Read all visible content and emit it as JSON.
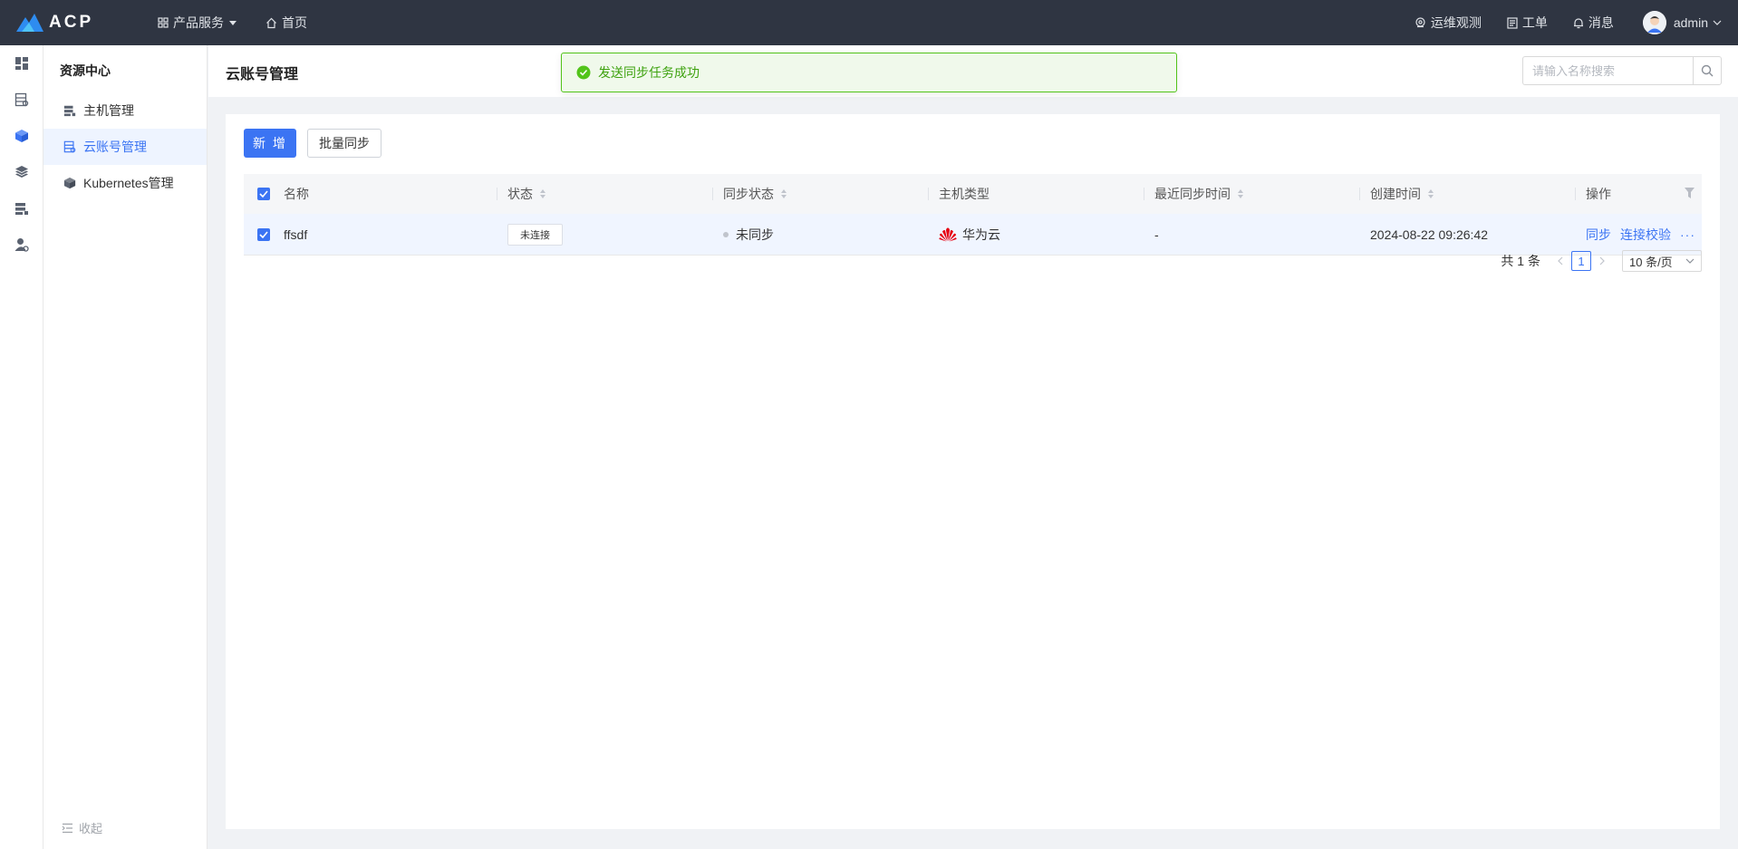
{
  "header": {
    "logo_text": "ACP",
    "nav": [
      {
        "label": "产品服务",
        "icon": "grid-icon"
      },
      {
        "label": "首页",
        "icon": "home-icon"
      }
    ],
    "right": [
      {
        "label": "运维观测",
        "icon": "location-icon"
      },
      {
        "label": "工单",
        "icon": "document-icon"
      },
      {
        "label": "消息",
        "icon": "bell-icon"
      }
    ],
    "user": "admin"
  },
  "rail": [
    "dashboard-icon",
    "resource-list-icon",
    "cube-icon",
    "layers-icon",
    "server-icon",
    "user-settings-icon"
  ],
  "sidebar": {
    "title": "资源中心",
    "items": [
      {
        "label": "主机管理",
        "icon": "server-icon",
        "active": false
      },
      {
        "label": "云账号管理",
        "icon": "cloud-account-icon",
        "active": true
      },
      {
        "label": "Kubernetes管理",
        "icon": "cube-icon",
        "active": false
      }
    ],
    "collapse_label": "收起"
  },
  "page": {
    "title": "云账号管理",
    "search_placeholder": "请输入名称搜索"
  },
  "toast": {
    "message": "发送同步任务成功",
    "type": "success"
  },
  "toolbar": {
    "add_label": "新 增",
    "batch_sync_label": "批量同步"
  },
  "table": {
    "columns": [
      "名称",
      "状态",
      "同步状态",
      "主机类型",
      "最近同步时间",
      "创建时间",
      "操作"
    ],
    "rows": [
      {
        "name": "ffsdf",
        "status": "未连接",
        "sync_status": "未同步",
        "host_type": "华为云",
        "last_sync": "-",
        "created": "2024-08-22 09:26:42",
        "actions": [
          "同步",
          "连接校验"
        ],
        "more": "···"
      }
    ]
  },
  "pagination": {
    "total_label": "共 1 条",
    "current_page": "1",
    "page_size": "10 条/页"
  },
  "colors": {
    "primary": "#3b74f3",
    "topbar": "#2f3542",
    "success": "#52c41a",
    "huawei_red": "#e60012"
  }
}
